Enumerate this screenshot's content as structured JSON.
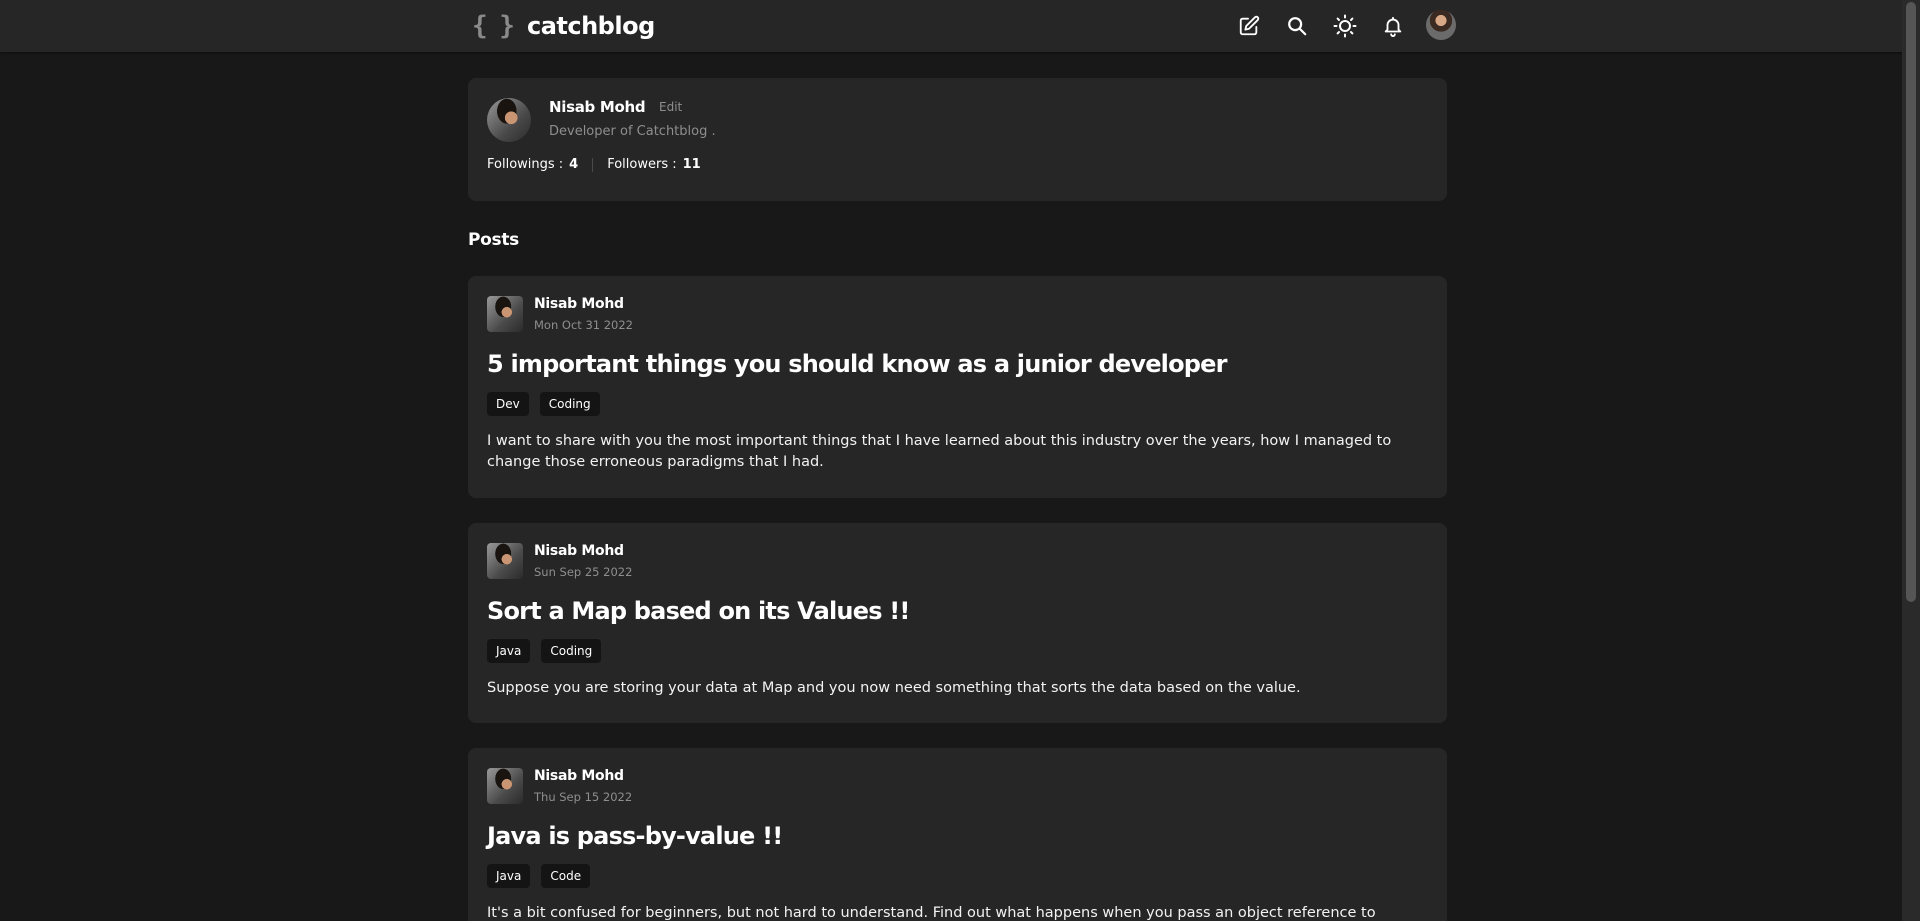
{
  "app": {
    "logo_glyph": "{ }",
    "logo_text": "catchblog"
  },
  "nav": {
    "icons": [
      "edit-icon",
      "search-icon",
      "sun-icon",
      "bell-icon",
      "user-avatar"
    ]
  },
  "profile": {
    "name": "Nisab Mohd",
    "edit_label": "Edit",
    "bio": "Developer of Catchtblog .",
    "followings_label": "Followings :",
    "followings_value": "4",
    "followers_label": "Followers :",
    "followers_value": "11"
  },
  "posts_section": {
    "title": "Posts"
  },
  "posts": [
    {
      "author": "Nisab Mohd",
      "date": "Mon Oct 31 2022",
      "title": "5 important things you should know as a junior developer",
      "tags": [
        "Dev",
        "Coding"
      ],
      "excerpt": "I want to share with you the most important things that I have learned about this industry over the years, how I managed to change those erroneous paradigms that I had."
    },
    {
      "author": "Nisab Mohd",
      "date": "Sun Sep 25 2022",
      "title": "Sort a Map based on its Values !!",
      "tags": [
        "Java",
        "Coding"
      ],
      "excerpt": "Suppose you are storing your data at Map and you now need something that sorts the data based on the value."
    },
    {
      "author": "Nisab Mohd",
      "date": "Thu Sep 15 2022",
      "title": "Java is pass-by-value !!",
      "tags": [
        "Java",
        "Code"
      ],
      "excerpt": "It's a bit confused for beginners, but not hard to understand. Find out what happens when you pass an object reference to"
    }
  ],
  "colors": {
    "background": "#181818",
    "surface": "#262626",
    "muted_text": "#8e8e8e",
    "tag_bg": "#141414"
  }
}
